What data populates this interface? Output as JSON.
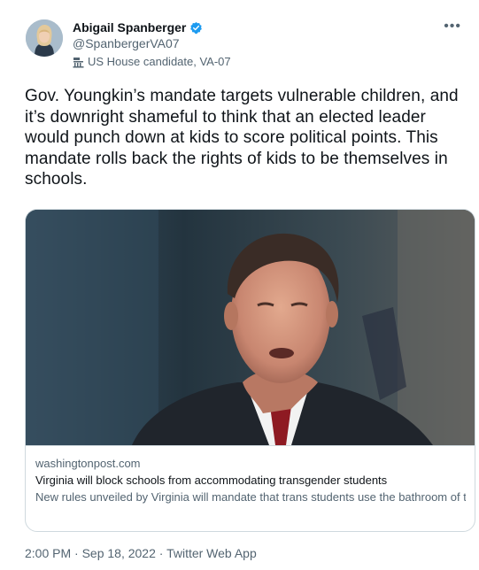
{
  "author": {
    "display_name": "Abigail Spanberger",
    "handle": "@SpanbergerVA07",
    "label": "US House candidate, VA-07",
    "verified": true
  },
  "tweet": {
    "text": "Gov. Youngkin’s mandate targets vulnerable children, and it’s downright shameful to think that an elected leader would punch down at kids to score political points. This mandate rolls back the rights of kids to be themselves in schools."
  },
  "card": {
    "domain": "washingtonpost.com",
    "title": "Virginia will block schools from accommodating transgender students",
    "description": "New rules unveiled by Virginia will mandate that trans students use the bathroom of the sex they were assigned at birth and direct educators to notify parents of ..."
  },
  "meta": {
    "timestamp": "2:00 PM · Sep 18, 2022 · Twitter Web App"
  },
  "icons": {
    "verified": "verified-badge-icon",
    "government": "government-building-icon",
    "more": "more-options-icon"
  },
  "colors": {
    "verified_blue": "#1d9bf0",
    "secondary_text": "#536471",
    "border": "#cfd9de"
  }
}
